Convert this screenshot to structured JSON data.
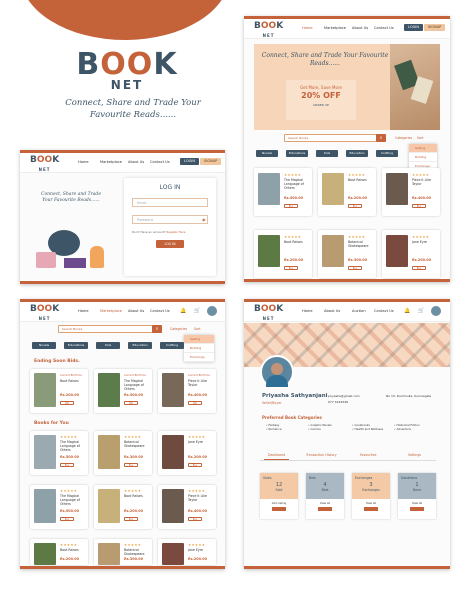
{
  "brand": {
    "logo_book": "BOOK",
    "logo_net": "NET",
    "tagline": "Connect, Share and Trade Your Favourite Reads......"
  },
  "nav": {
    "home": "Home",
    "marketplace": "Marketplace",
    "about": "About Us",
    "contact": "Contact Us",
    "login": "LOGIN",
    "signup": "SIGNUP",
    "auction": "Auction"
  },
  "login": {
    "title": "LOG IN",
    "email_placeholder": "Email",
    "password_placeholder": "Password",
    "forgot": "Don't Have an account?",
    "register": "Register Here",
    "button": "LOG IN",
    "tagline": "Connect, Share and Trade Your Favourite Reads......"
  },
  "home": {
    "hero_title": "Connect, Share and Trade Your Favourite Reads......",
    "promo_line1": "Get More, Save More",
    "promo_line2": "20% OFF",
    "promo_cta": "ORDER UP"
  },
  "search": {
    "placeholder": "Search Books",
    "categories": "Categories",
    "sort": "Sort"
  },
  "dropdown": [
    "Selling",
    "Bidding",
    "Exchange"
  ],
  "categories": [
    "Novels",
    "Educations",
    "Kids",
    "Education",
    "Crafting"
  ],
  "books_row1": [
    {
      "title": "The Magical Language of Others",
      "author": "E.J. Koh",
      "price": "Rs.500.00"
    },
    {
      "title": "Boot Raises",
      "author": "By Alicia",
      "price": "Rs.200.00"
    },
    {
      "title": "Piece it Like Taylor",
      "author": "By Unoh",
      "price": "Rs.400.00"
    }
  ],
  "books_row2": [
    {
      "title": "Boot Raises",
      "author": "By Alicia",
      "price": "Rs.200.00"
    },
    {
      "title": "Botanical Shakespeare",
      "author": "By Gerit",
      "price": "Rs.300.00"
    },
    {
      "title": "Jane Eyre",
      "author": "By Bronte",
      "price": "Rs.200.00"
    }
  ],
  "market": {
    "ending_soon": "Ending Soon Bids.",
    "books_for_you": "Books for You",
    "bid_label": "Current Bid Price"
  },
  "profile": {
    "name": "Priyasha Sathyanjani",
    "role": "Seller/Buyer",
    "email": "priyasha@gmail.com",
    "phone": "077 3224546",
    "address": "No 15, Dummulla, Kurunegala",
    "preferred_title": "Preferred Book Categories",
    "preferred": [
      "Fantasy",
      "Romance",
      "Graphic Novels",
      "Comics",
      "Cookbooks",
      "Health and Wellness",
      "Historical Fiction",
      "Adventure"
    ],
    "tabs": [
      "Dashboard",
      "Transaction History",
      "Favourites",
      "Settings"
    ],
    "stats": [
      {
        "label": "Sales",
        "value": "12",
        "unit": "Sold",
        "cta": "Add Listing",
        "color": "#f4c9a6"
      },
      {
        "label": "Bids",
        "value": "4",
        "unit": "Bids",
        "cta": "View All",
        "color": "#a9b8c2"
      },
      {
        "label": "Exchanges",
        "value": "3",
        "unit": "Exchanges",
        "cta": "View All",
        "color": "#f4c9a6"
      },
      {
        "label": "Donations",
        "value": "1",
        "unit": "Done",
        "cta": "View All",
        "color": "#a9b8c2"
      }
    ]
  },
  "colors": {
    "accent": "#c4623a",
    "navy": "#3d5567",
    "peach": "#f4c9a6"
  }
}
